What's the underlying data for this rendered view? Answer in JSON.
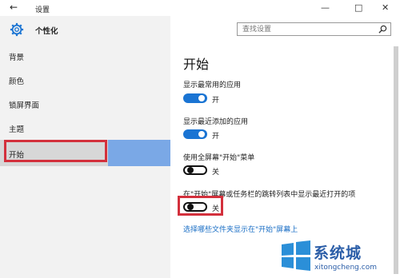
{
  "window": {
    "title": "设置",
    "back_icon": "arrow-left-icon",
    "controls": [
      "minimize-icon",
      "maximize-icon",
      "close-icon"
    ]
  },
  "sidebar": {
    "header": "个性化",
    "header_icon": "gear-icon",
    "items": [
      {
        "label": "背景"
      },
      {
        "label": "颜色"
      },
      {
        "label": "锁屏界面"
      },
      {
        "label": "主题"
      },
      {
        "label": "开始",
        "selected": true
      }
    ]
  },
  "search": {
    "placeholder": "查找设置",
    "icon": "search-icon"
  },
  "main": {
    "title": "开始",
    "settings": [
      {
        "label": "显示最常用的应用",
        "state": "开",
        "on": true
      },
      {
        "label": "显示最近添加的应用",
        "state": "开",
        "on": true
      },
      {
        "label": "使用全屏幕\"开始\"菜单",
        "state": "关",
        "on": false
      },
      {
        "label": "在\"开始\"屏幕或任务栏的跳转列表中显示最近打开的项",
        "state": "关",
        "on": false
      }
    ],
    "link": "选择哪些文件夹显示在\"开始\"屏幕上"
  },
  "watermark": {
    "brand": "系统城",
    "url": "xitongcheng.com"
  },
  "colors": {
    "accent": "#1a74d3",
    "highlight": "#d3303c",
    "link": "#1a6ec5"
  }
}
